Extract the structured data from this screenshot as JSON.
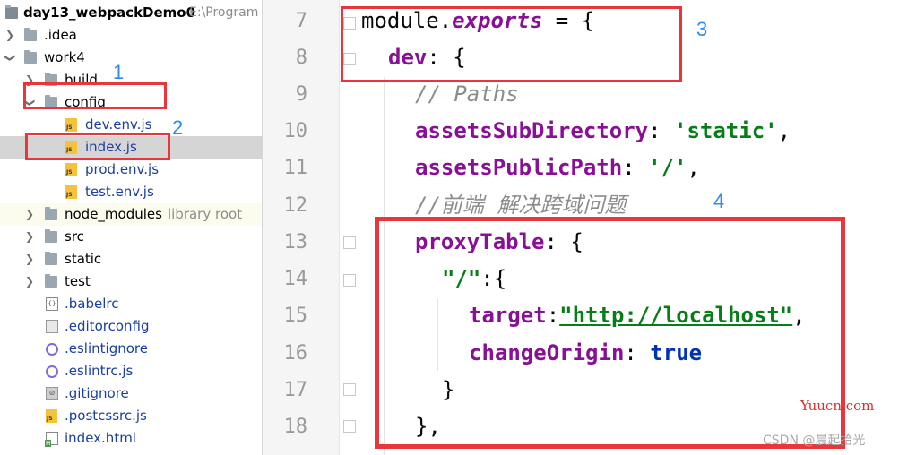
{
  "project": {
    "name": "day13_webpackDemo0",
    "path_hint": "E:\\Program"
  },
  "tree": [
    {
      "label": ".idea"
    },
    {
      "label": "work4"
    },
    {
      "label": "build"
    },
    {
      "label": "config"
    },
    {
      "label": "dev.env.js"
    },
    {
      "label": "index.js"
    },
    {
      "label": "prod.env.js"
    },
    {
      "label": "test.env.js"
    },
    {
      "label": "node_modules",
      "hint": "library root"
    },
    {
      "label": "src"
    },
    {
      "label": "static"
    },
    {
      "label": "test"
    },
    {
      "label": ".babelrc"
    },
    {
      "label": ".editorconfig"
    },
    {
      "label": ".eslintignore"
    },
    {
      "label": ".eslintrc.js"
    },
    {
      "label": ".gitignore"
    },
    {
      "label": ".postcssrc.js"
    },
    {
      "label": "index.html"
    }
  ],
  "annotations": [
    "1",
    "2",
    "3",
    "4"
  ],
  "line_numbers": [
    "7",
    "8",
    "9",
    "10",
    "11",
    "12",
    "13",
    "14",
    "15",
    "16",
    "17",
    "18"
  ],
  "code": {
    "l7": {
      "a": "module",
      "b": ".",
      "c": "exports",
      "d": " = {"
    },
    "l8": {
      "a": "dev",
      "b": ": {"
    },
    "l9": {
      "a": "// Paths"
    },
    "l10": {
      "a": "assetsSubDirectory",
      "b": ": ",
      "c": "'static'",
      "d": ","
    },
    "l11": {
      "a": "assetsPublicPath",
      "b": ": ",
      "c": "'/'",
      "d": ","
    },
    "l12": {
      "a": "//前端 解决跨域问题"
    },
    "l13": {
      "a": "proxyTable",
      "b": ": {"
    },
    "l14": {
      "a": "\"/\"",
      "b": ":{"
    },
    "l15": {
      "a": "target",
      "b": ":",
      "c": "\"http://localhost\"",
      "d": ","
    },
    "l16": {
      "a": "changeOrigin",
      "b": ": ",
      "c": "true"
    },
    "l17": {
      "a": "}"
    },
    "l18": {
      "a": "},"
    }
  },
  "watermarks": {
    "site": "Yuucn.com",
    "author": "CSDN @晨起拾光"
  },
  "colors": {
    "annotation_blue": "#2d8de8",
    "highlight_red": "#e8363c",
    "selected_row": "#d5d5d5"
  }
}
